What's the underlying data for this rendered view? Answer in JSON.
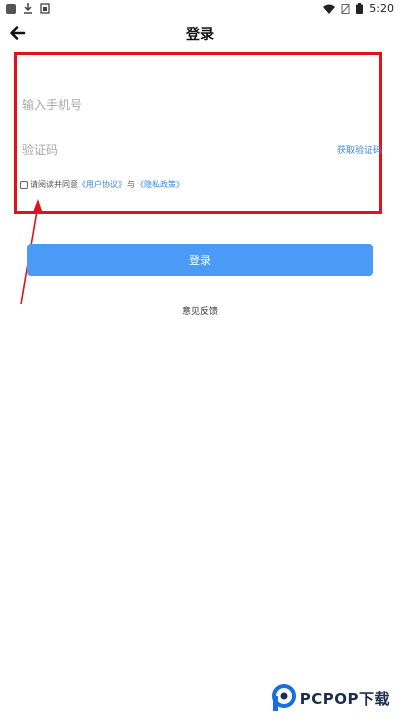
{
  "status_bar": {
    "time": "5:20",
    "icons": [
      "app-icon",
      "download-icon",
      "sim-icon",
      "wifi-icon",
      "no-sim-icon",
      "battery-icon"
    ]
  },
  "header": {
    "back_icon": "arrow-left-icon",
    "title": "登录"
  },
  "form": {
    "phone_placeholder": "输入手机号",
    "phone_value": "",
    "code_placeholder": "验证码",
    "code_value": "",
    "get_code_label": "获取验证码",
    "agree": {
      "checked": false,
      "prefix": "请阅读并同意",
      "user_agreement": "《用户协议》",
      "joiner": "与",
      "privacy_policy": "《隐私政策》"
    }
  },
  "actions": {
    "login_label": "登录",
    "feedback_label": "意见反馈"
  },
  "watermark": {
    "text": "PCPOP下载"
  },
  "colors": {
    "accent": "#4a9bf5",
    "link": "#3a86e8",
    "annotation": "#e0131b"
  }
}
